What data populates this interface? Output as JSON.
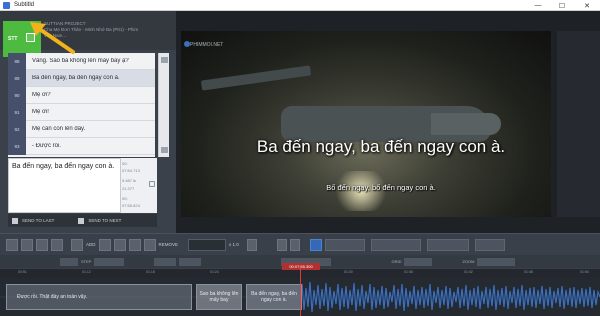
{
  "window": {
    "title": "Subtitld",
    "controls": {
      "minimize": "—",
      "maximize": "☐",
      "close": "✕"
    }
  },
  "left_panel": {
    "active_code": "STT",
    "header_lines": [
      "SUTTIAN PROJECT",
      "Cha Mẹ Đơn Thân - Minh Nhớ Ba (P01) - Phim",
      "Việt Nam..."
    ],
    "rows": [
      {
        "num": "88",
        "text": "Vâng. Sao ba không lên máy bay ạ?"
      },
      {
        "num": "89",
        "text": "Ba đến ngay, ba đến ngay con à."
      },
      {
        "num": "90",
        "text": "Mẹ ơi?"
      },
      {
        "num": "91",
        "text": "Mẹ ơi!"
      },
      {
        "num": "92",
        "text": "Mẹ cần con lên đây."
      },
      {
        "num": "93",
        "text": "- Được rồi."
      }
    ],
    "edit_text": "Ba đến ngay, ba đến ngay con à.",
    "times": [
      "00:",
      "07:54.713",
      "9.487 ik",
      "21.377",
      "00:",
      "07:55.624"
    ],
    "send_to_last": "SEND TO LAST",
    "send_to_next": "SEND TO NEXT"
  },
  "video": {
    "watermark": "PHIMMOI.NET",
    "subtitle_main": "Ba đến ngay, ba đến ngay con à.",
    "subtitle_secondary": "Bố đến ngay, bố đến ngay con à."
  },
  "toolbar": {
    "add_label": "ADD",
    "remove_label": "REMOVE",
    "speed": "x 1.0"
  },
  "toolbar2": {
    "step_label": "STEP",
    "grid_label": "GRID",
    "zoom_label": "ZOOM"
  },
  "timeline": {
    "ticks": [
      "00:51",
      "01:12",
      "01:18",
      "01:24",
      "01:30",
      "01:36",
      "01:42",
      "01:48",
      "01:54"
    ],
    "playhead_time": "00:07:55.300",
    "segments": [
      "Được rồi. Thật đáy an toàn vậy.",
      "Sao ba không lên máy bay",
      "Ba đến ngay, ba đến ngay con à."
    ]
  }
}
